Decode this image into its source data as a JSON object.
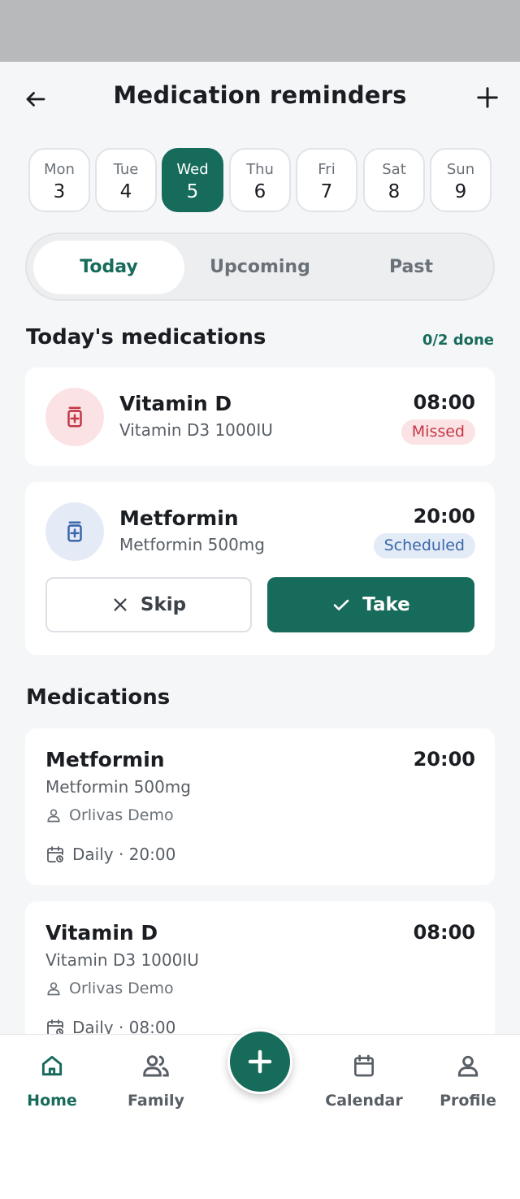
{
  "header": {
    "title": "Medication reminders",
    "back_icon": "arrow-left-icon",
    "add_icon": "plus-icon"
  },
  "days": [
    {
      "name": "Mon",
      "num": "3",
      "selected": false
    },
    {
      "name": "Tue",
      "num": "4",
      "selected": false
    },
    {
      "name": "Wed",
      "num": "5",
      "selected": true
    },
    {
      "name": "Thu",
      "num": "6",
      "selected": false
    },
    {
      "name": "Fri",
      "num": "7",
      "selected": false
    },
    {
      "name": "Sat",
      "num": "8",
      "selected": false
    },
    {
      "name": "Sun",
      "num": "9",
      "selected": false
    }
  ],
  "tabs": [
    {
      "label": "Today",
      "active": true
    },
    {
      "label": "Upcoming",
      "active": false
    },
    {
      "label": "Past",
      "active": false
    }
  ],
  "today": {
    "title": "Today's medications",
    "done_count": "0/2 done",
    "items": [
      {
        "name": "Vitamin D",
        "dose": "Vitamin D3 1000IU",
        "time": "08:00",
        "status": "Missed",
        "icon": "medicine-bottle-icon"
      },
      {
        "name": "Metformin",
        "dose": "Metformin 500mg",
        "time": "20:00",
        "status": "Scheduled",
        "icon": "medicine-bottle-icon",
        "skip_label": "Skip",
        "take_label": "Take"
      }
    ]
  },
  "medications": {
    "title": "Medications",
    "items": [
      {
        "name": "Metformin",
        "time": "20:00",
        "dose": "Metformin 500mg",
        "owner": "Orlivas Demo",
        "schedule": "Daily · 20:00"
      },
      {
        "name": "Vitamin D",
        "time": "08:00",
        "dose": "Vitamin D3 1000IU",
        "owner": "Orlivas Demo",
        "schedule": "Daily · 08:00"
      }
    ]
  },
  "nav": [
    {
      "label": "Home",
      "icon": "home-icon",
      "active": true
    },
    {
      "label": "Family",
      "icon": "family-icon",
      "active": false
    },
    {
      "label": "Calendar",
      "icon": "calendar-icon",
      "active": false
    },
    {
      "label": "Profile",
      "icon": "profile-icon",
      "active": false
    }
  ],
  "colors": {
    "primary": "#176b5b",
    "missed": "#c33846",
    "scheduled": "#3a67ab",
    "background": "#f5f6f8"
  }
}
